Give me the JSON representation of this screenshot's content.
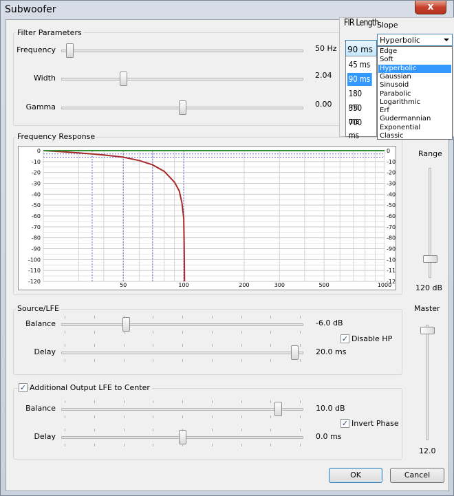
{
  "window": {
    "title": "Subwoofer",
    "close_glyph": "x"
  },
  "filter": {
    "group_label": "Filter Parameters",
    "frequency": {
      "label": "Frequency",
      "value": "50 Hz",
      "position": 0.02
    },
    "width": {
      "label": "Width",
      "value": "2.04",
      "position": 0.25
    },
    "gamma": {
      "label": "Gamma",
      "value": "0.00",
      "position": 0.5
    }
  },
  "fir": {
    "title": "FIR Length",
    "selected": "90 ms",
    "options": [
      "45 ms",
      "90 ms",
      "180 ms",
      "350 ms",
      "700 ms"
    ]
  },
  "slope": {
    "title": "Slope",
    "selected": "Hyperbolic",
    "options": [
      "Edge",
      "Soft",
      "Hyperbolic",
      "Gaussian",
      "Sinusoid",
      "Parabolic",
      "Logarithmic",
      "Erf",
      "Gudermannian",
      "Exponential",
      "Classic"
    ]
  },
  "response": {
    "group_label": "Frequency Response",
    "range_label": "Range",
    "range_value": "120 dB",
    "range_position": 0.85
  },
  "chart_data": {
    "type": "line",
    "x_scale": "log",
    "xlim": [
      20,
      1000
    ],
    "ylim": [
      -120,
      0
    ],
    "x_ticks": [
      "50",
      "100",
      "200",
      "300",
      "500",
      "1000"
    ],
    "y_ticks": [
      "0",
      "-10",
      "-20",
      "-30",
      "-40",
      "-50",
      "-60",
      "-70",
      "-80",
      "-90",
      "-100",
      "-110",
      "-120"
    ],
    "series": [
      {
        "color": "#a52a2a",
        "x": [
          20,
          25,
          30,
          35,
          40,
          50,
          60,
          70,
          80,
          90,
          95,
          98,
          100,
          100.5,
          101
        ],
        "y": [
          0,
          -1,
          -2,
          -3,
          -4,
          -6,
          -9,
          -13,
          -19,
          -29,
          -37,
          -48,
          -62,
          -85,
          -120
        ]
      },
      {
        "color": "#2e8b2e",
        "x": [
          20,
          1000
        ],
        "y": [
          0,
          0
        ]
      }
    ],
    "reference_lines_db": [
      -3,
      -6
    ],
    "vertical_markers_hz": [
      35,
      50,
      70,
      100
    ]
  },
  "source_lfe": {
    "group_label": "Source/LFE",
    "balance": {
      "label": "Balance",
      "value": "-6.0 dB",
      "position": 0.26
    },
    "disable_hp": {
      "label": "Disable HP",
      "checked": true,
      "mark": "✓"
    },
    "delay": {
      "label": "Delay",
      "value": "20.0 ms",
      "position": 0.98
    }
  },
  "master": {
    "label": "Master",
    "value": "12.0",
    "position": 0.02
  },
  "additional": {
    "label": "Additional Output LFE to Center",
    "checked": true,
    "mark": "✓",
    "balance": {
      "label": "Balance",
      "value": "10.0 dB",
      "position": 0.91
    },
    "invert_phase": {
      "label": "Invert Phase",
      "checked": true,
      "mark": "✓"
    },
    "delay": {
      "label": "Delay",
      "value": "0.0 ms",
      "position": 0.5
    }
  },
  "buttons": {
    "ok": "OK",
    "cancel": "Cancel"
  }
}
